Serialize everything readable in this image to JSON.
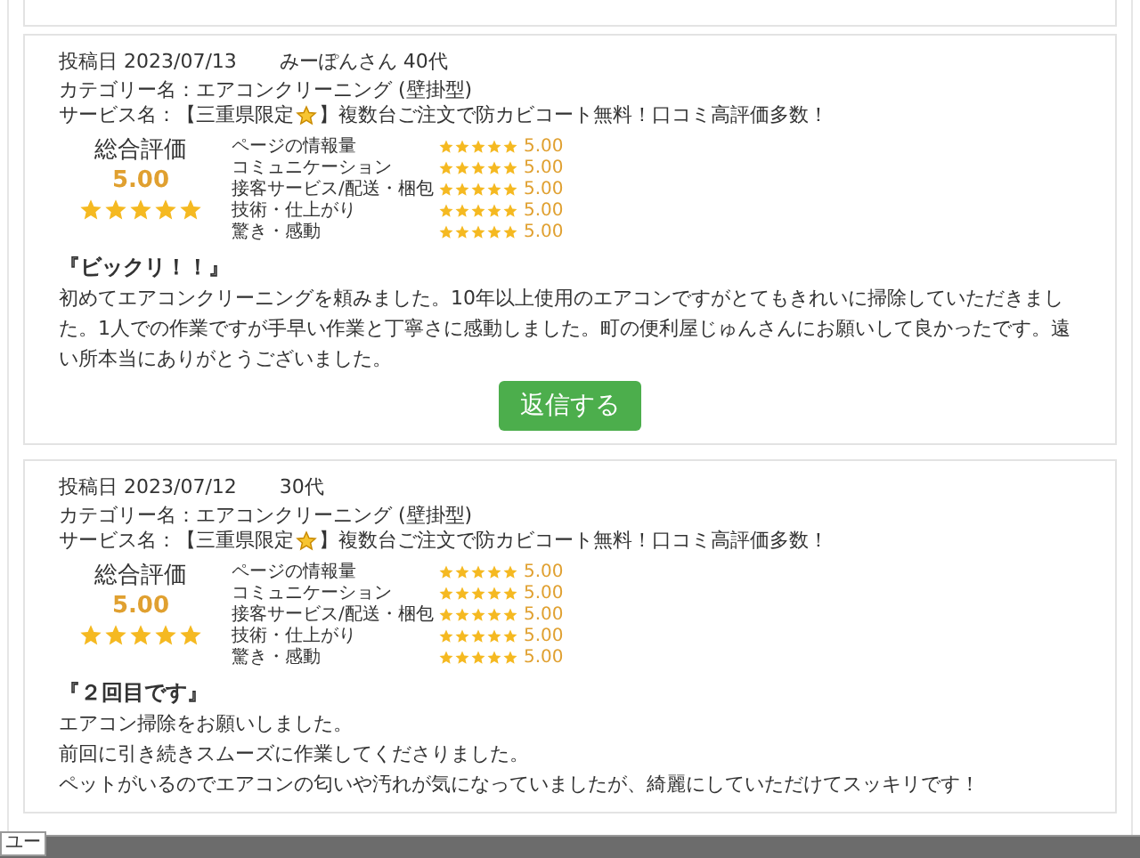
{
  "reviews": [
    {
      "date": "投稿日 2023/07/13",
      "reviewer": "みーぽんさん 40代",
      "category": "カテゴリー名：エアコンクリーニング (壁掛型)",
      "service_before": "サービス名：【三重県限定",
      "service_after": "】複数台ご注文で防カビコート無料！口コミ高評価多数！",
      "overall_label": "総合評価",
      "overall_score": "5.00",
      "stars": 5,
      "ratings": [
        {
          "label": "ページの情報量",
          "stars": 5,
          "score": "5.00"
        },
        {
          "label": "コミュニケーション",
          "stars": 5,
          "score": "5.00"
        },
        {
          "label": "接客サービス/配送・梱包",
          "stars": 5,
          "score": "5.00"
        },
        {
          "label": "技術・仕上がり",
          "stars": 5,
          "score": "5.00"
        },
        {
          "label": "驚き・感動",
          "stars": 5,
          "score": "5.00"
        }
      ],
      "title": "『ビックリ！！』",
      "body": [
        "初めてエアコンクリーニングを頼みました。10年以上使用のエアコンですがとてもきれいに掃除していただきました。1人での作業ですが手早い作業と丁寧さに感動しました。町の便利屋じゅんさんにお願いして良かったです。遠い所本当にありがとうございました。"
      ],
      "reply_button": "返信する"
    },
    {
      "date": "投稿日 2023/07/12",
      "reviewer": "30代",
      "category": "カテゴリー名：エアコンクリーニング (壁掛型)",
      "service_before": "サービス名：【三重県限定",
      "service_after": "】複数台ご注文で防カビコート無料！口コミ高評価多数！",
      "overall_label": "総合評価",
      "overall_score": "5.00",
      "stars": 5,
      "ratings": [
        {
          "label": "ページの情報量",
          "stars": 5,
          "score": "5.00"
        },
        {
          "label": "コミュニケーション",
          "stars": 5,
          "score": "5.00"
        },
        {
          "label": "接客サービス/配送・梱包",
          "stars": 5,
          "score": "5.00"
        },
        {
          "label": "技術・仕上がり",
          "stars": 5,
          "score": "5.00"
        },
        {
          "label": "驚き・感動",
          "stars": 5,
          "score": "5.00"
        }
      ],
      "title": "『２回目です』",
      "body": [
        "エアコン掃除をお願いしました。",
        "前回に引き続きスムーズに作業してくださりました。",
        "ペットがいるのでエアコンの匂いや汚れが気になっていましたが、綺麗にしていただけてスッキリです！"
      ]
    }
  ],
  "bottom_tab": "ユー"
}
